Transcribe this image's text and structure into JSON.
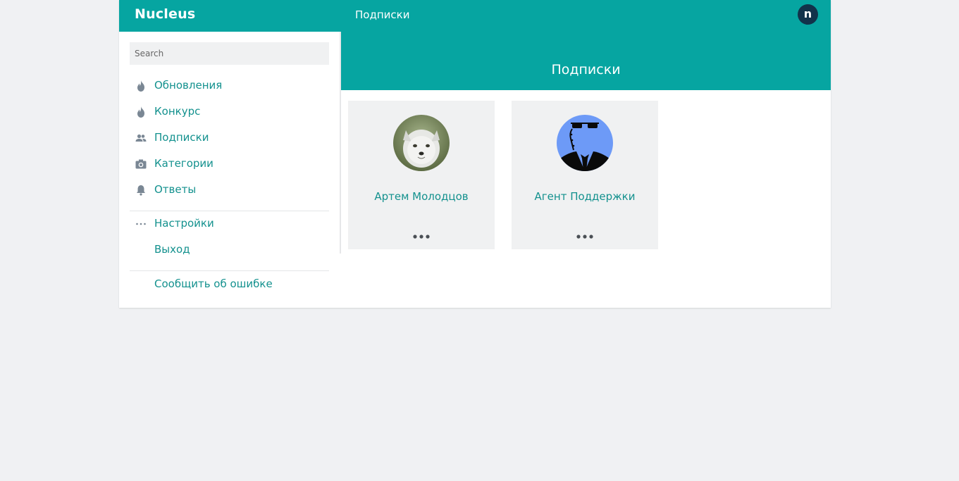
{
  "header": {
    "brand": "Nucleus",
    "title": "Подписки",
    "avatar_letter": "n"
  },
  "sidebar": {
    "search_placeholder": "Search",
    "items": [
      {
        "label": "Обновления",
        "icon": "fire-icon"
      },
      {
        "label": "Конкурс",
        "icon": "fire-icon"
      },
      {
        "label": "Подписки",
        "icon": "people-icon"
      },
      {
        "label": "Категории",
        "icon": "camera-icon"
      },
      {
        "label": "Ответы",
        "icon": "bell-icon"
      }
    ],
    "settings_label": "Настройки",
    "logout_label": "Выход",
    "report_label": "Сообщить об ошибке"
  },
  "main": {
    "title": "Подписки",
    "cards": [
      {
        "name": "Артем Молодцов",
        "avatar": "arctic-fox-photo"
      },
      {
        "name": "Агент Поддержки",
        "avatar": "agent-silhouette"
      }
    ]
  },
  "colors": {
    "accent": "#06a5a1",
    "link": "#13918e",
    "background": "#f0f1f3",
    "icon": "#7a8794",
    "avatar_badge": "#12324a"
  }
}
